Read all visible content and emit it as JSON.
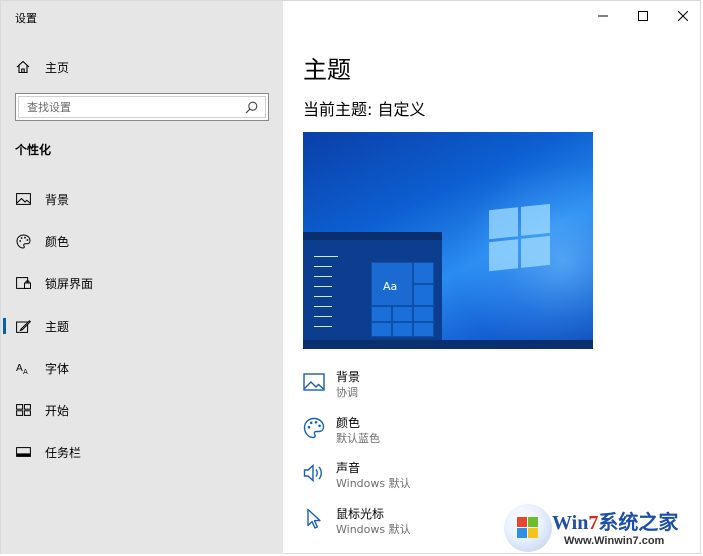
{
  "window": {
    "title": "设置",
    "controls": {
      "minimize": "—",
      "maximize": "☐",
      "close": "✕"
    }
  },
  "sidebar": {
    "home_label": "主页",
    "search_placeholder": "查找设置",
    "section_title": "个性化",
    "items": [
      {
        "label": "背景",
        "icon": "picture-icon",
        "active": false
      },
      {
        "label": "颜色",
        "icon": "palette-icon",
        "active": false
      },
      {
        "label": "锁屏界面",
        "icon": "lock-screen-icon",
        "active": false
      },
      {
        "label": "主题",
        "icon": "theme-icon",
        "active": true
      },
      {
        "label": "字体",
        "icon": "font-icon",
        "active": false
      },
      {
        "label": "开始",
        "icon": "start-icon",
        "active": false
      },
      {
        "label": "任务栏",
        "icon": "taskbar-icon",
        "active": false
      }
    ]
  },
  "main": {
    "title": "主题",
    "current_theme": "当前主题: 自定义",
    "preview": {
      "tile_label": "Aa"
    },
    "options": [
      {
        "title": "背景",
        "subtitle": "协调",
        "icon": "picture-icon"
      },
      {
        "title": "颜色",
        "subtitle": "默认蓝色",
        "icon": "palette-icon"
      },
      {
        "title": "声音",
        "subtitle": "Windows 默认",
        "icon": "speaker-icon"
      },
      {
        "title": "鼠标光标",
        "subtitle": "Windows 默认",
        "icon": "cursor-icon"
      }
    ]
  },
  "watermark": {
    "title_part1": "Win",
    "title_part2": "7",
    "title_part3": "系统之家",
    "url": "Www.Winwin7.com"
  },
  "colors": {
    "accent": "#0063b1",
    "sidebar_bg": "#e6e6e6",
    "icon_blue": "#1a5fb4",
    "watermark_red": "#d9251c",
    "watermark_blue": "#1d4fa8"
  }
}
